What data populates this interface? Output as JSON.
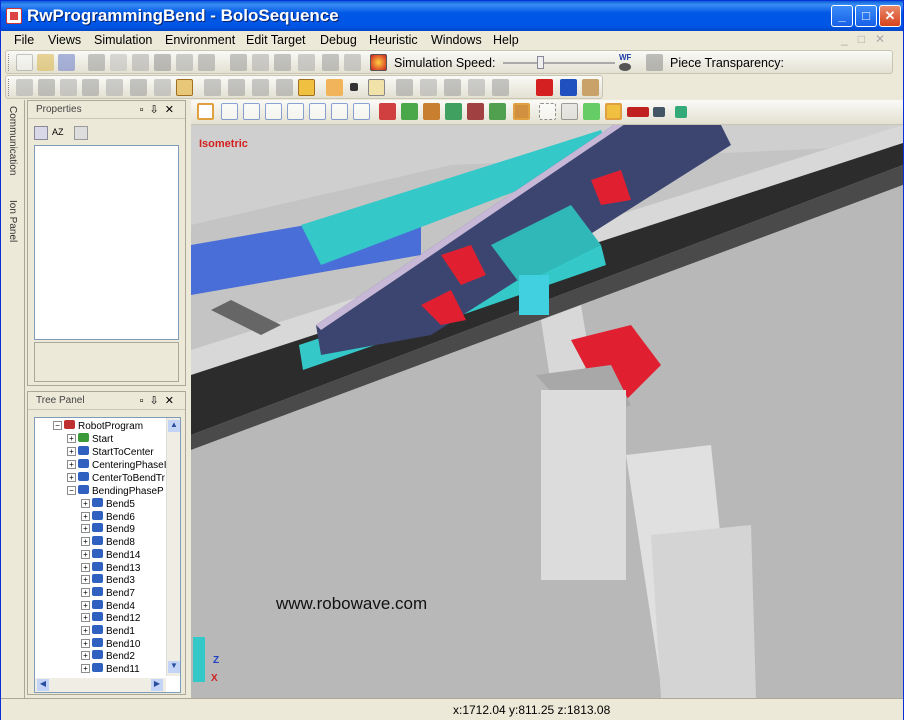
{
  "window": {
    "title": "RwProgrammingBend - BoloSequence"
  },
  "menu": [
    "File",
    "Views",
    "Simulation",
    "Environment",
    "Edit Target",
    "Debug",
    "Heuristic",
    "Windows",
    "Help"
  ],
  "toolbar": {
    "simulation_speed_label": "Simulation Speed:",
    "simulation_speed_level": 0.32,
    "wf_label": "WF",
    "piece_transparency_label": "Piece Transparency:"
  },
  "left_strip": {
    "tab1": "Communication",
    "tab2": "Ion Panel"
  },
  "properties_panel": {
    "title": "Properties",
    "sort_label": "AZ"
  },
  "tree_panel": {
    "title": "Tree Panel",
    "root": "RobotProgram",
    "items": [
      "Start",
      "StartToCenter",
      "CenteringPhaseI",
      "CenterToBendTr",
      "BendingPhaseP"
    ],
    "bends": [
      "Bend5",
      "Bend6",
      "Bend9",
      "Bend8",
      "Bend14",
      "Bend13",
      "Bend3",
      "Bend7",
      "Bend4",
      "Bend12",
      "Bend1",
      "Bend10",
      "Bend2",
      "Bend11"
    ]
  },
  "viewport": {
    "view_name": "Isometric",
    "watermark": "www.robowave.com",
    "axis_z": "Z",
    "axis_x": "X"
  },
  "status": {
    "coordinates": "x:1712.04 y:811.25 z:1813.08"
  },
  "colors": {
    "accent_red": "#d42020",
    "cyan_part": "#33d0d0",
    "title_blue": "#0055e5"
  }
}
